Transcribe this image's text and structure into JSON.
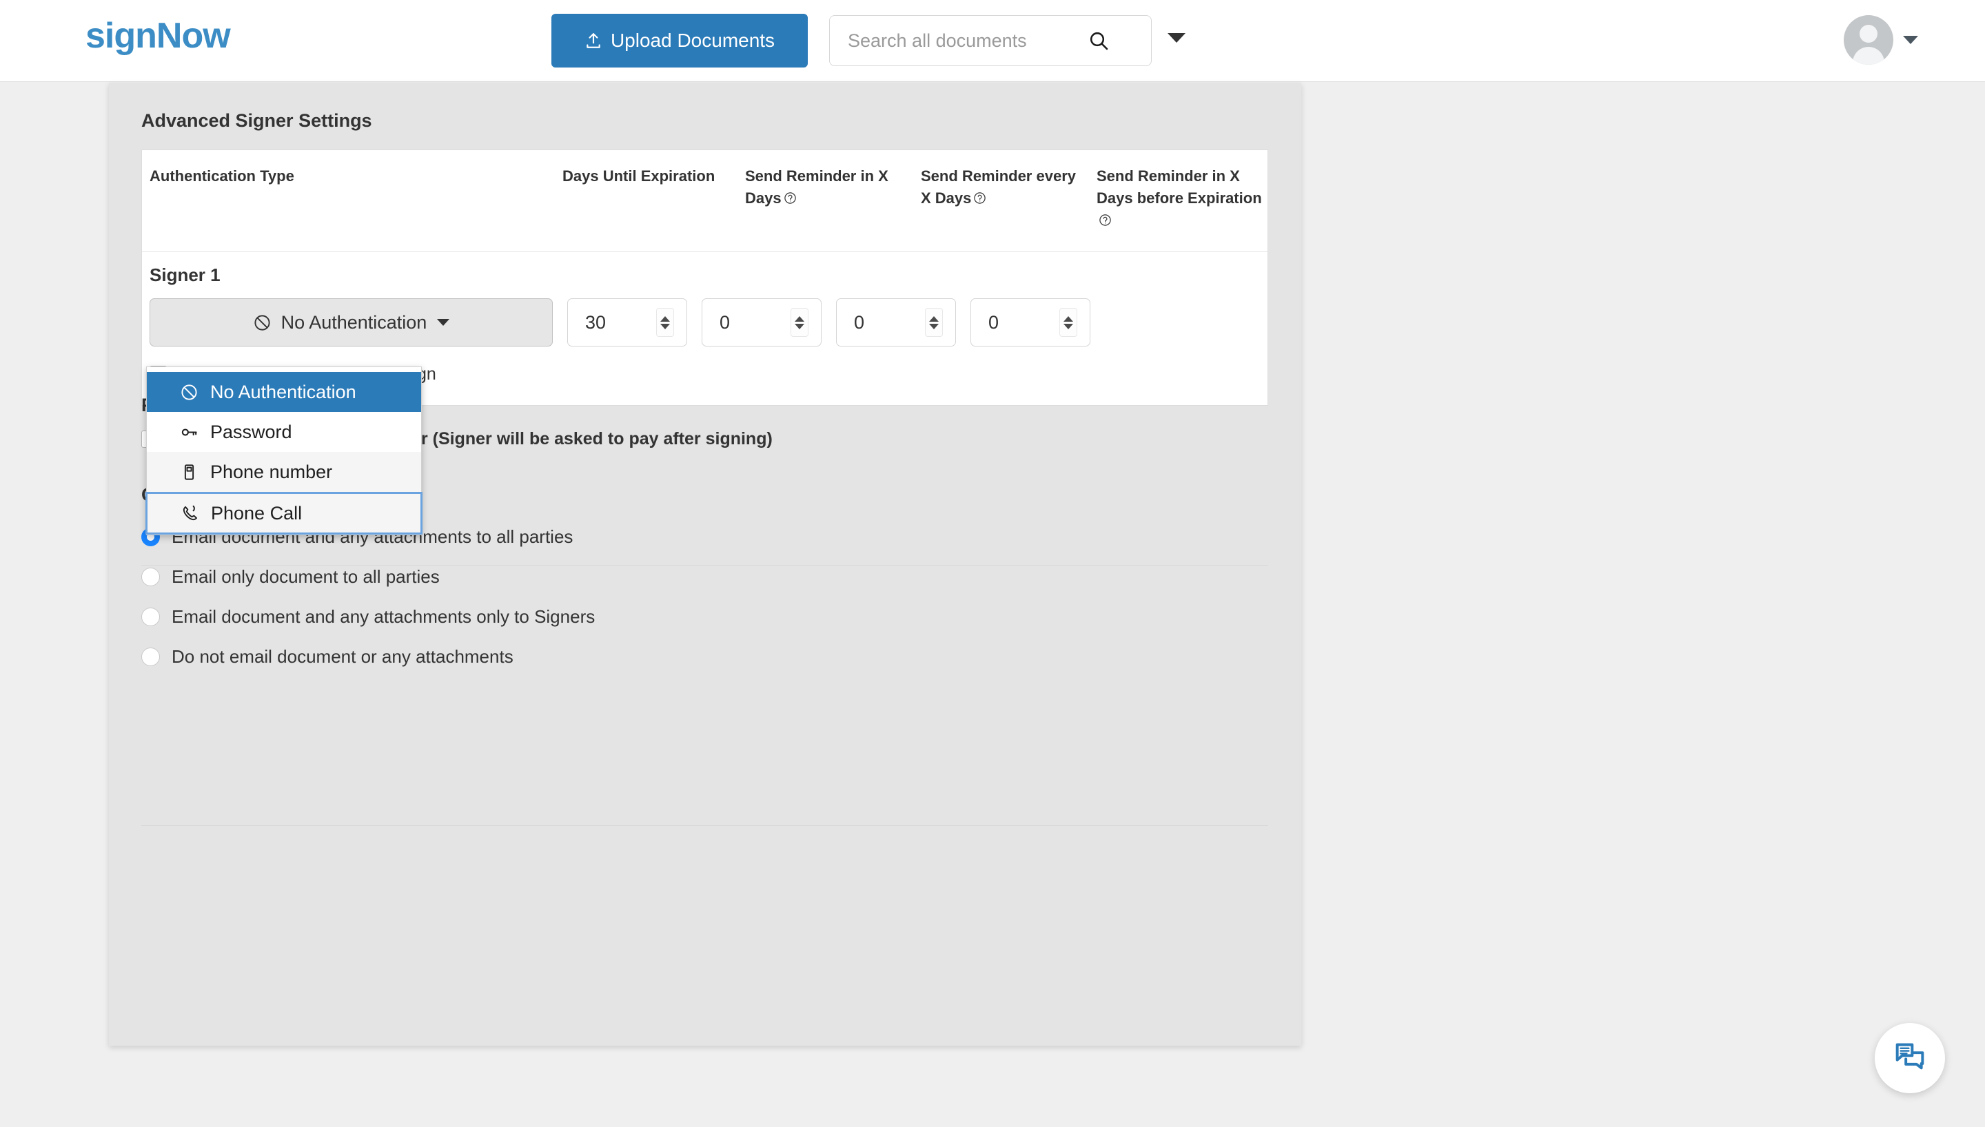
{
  "header": {
    "logo_part1": "sign",
    "logo_part2": "Now",
    "upload_label": "Upload Documents",
    "upload_icon": "upload-icon",
    "search_placeholder": "Search all documents",
    "search_value": "",
    "search_icon": "search-icon",
    "search_caret_icon": "chevron-down-icon",
    "avatar_icon": "user-avatar",
    "avatar_caret_icon": "chevron-down-icon"
  },
  "advanced_signer_settings": {
    "title": "Advanced Signer Settings",
    "columns": [
      "Authentication Type",
      "Days Until Expiration",
      "Send Reminder in X Days",
      "Send Reminder every X Days",
      "Send Reminder in X Days before Expiration"
    ],
    "signer_label": "Signer 1",
    "auth_value": "No Authentication",
    "auth_icon": "no-authentication-icon",
    "days_until_expiration": "30",
    "send_reminder_in_x_days": "0",
    "send_reminder_every_x_days": "0",
    "send_reminder_before_expiration": "0",
    "decline_label": "Allow Recipient to Decline to Sign",
    "decline_checked": false
  },
  "auth_dropdown": {
    "open": true,
    "options": [
      {
        "label": "No Authentication",
        "icon": "no-authentication-icon",
        "state": "selected"
      },
      {
        "label": "Password",
        "icon": "key-icon",
        "state": "normal"
      },
      {
        "label": "Phone number",
        "icon": "mobile-phone-icon",
        "state": "alt"
      },
      {
        "label": "Phone Call",
        "icon": "phone-call-icon",
        "state": "focused"
      }
    ]
  },
  "payment_settings": {
    "title": "Payment Settings",
    "request_payment_label": "Request payment from a signer (Signer will be asked to pay after signing)",
    "request_payment_checked": false
  },
  "on_completion": {
    "title": "On completion:",
    "selected_index": 0,
    "options": [
      "Email document and any attachments to all parties",
      "Email only document to all parties",
      "Email document and any attachments only to Signers",
      "Do not email document or any attachments"
    ]
  },
  "chat_widget": {
    "icon": "chat-bubbles-icon"
  },
  "colors": {
    "brand_blue": "#2b7bb9",
    "logo_blue": "#3c8dc5",
    "radio_blue": "#1a85ff",
    "focus_blue": "#6aa3e0",
    "page_bg": "#efefef",
    "card_bg": "#e4e4e4"
  }
}
